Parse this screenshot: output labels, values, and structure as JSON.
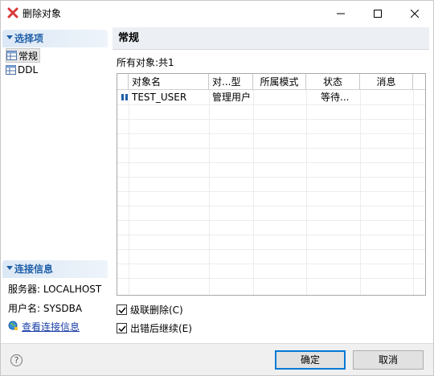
{
  "window": {
    "title": "删除对象"
  },
  "left": {
    "selection_header": "选择项",
    "nav": [
      {
        "label": "常规",
        "selected": true
      },
      {
        "label": "DDL",
        "selected": false
      }
    ],
    "connection_header": "连接信息",
    "server": "服务器: LOCALHOST",
    "user": "用户名: SYSDBA",
    "view_conn_link": "查看连接信息"
  },
  "main": {
    "page_title": "常规",
    "count_label": "所有对象:共1",
    "columns": [
      "对象名",
      "对...型",
      "所属模式",
      "状态",
      "消息"
    ],
    "rows": [
      {
        "name": "TEST_USER",
        "type": "管理用户",
        "schema": "",
        "status": "等待...",
        "message": ""
      }
    ],
    "cascade_delete": {
      "label": "级联删除(C)",
      "checked": true
    },
    "continue_on_error": {
      "label": "出错后继续(E)",
      "checked": true
    }
  },
  "footer": {
    "help": "?",
    "ok": "确定",
    "cancel": "取消"
  },
  "colors": {
    "accent": "#1f5fa8",
    "link": "#1a3fa8",
    "close_x": "#d83a3a"
  }
}
